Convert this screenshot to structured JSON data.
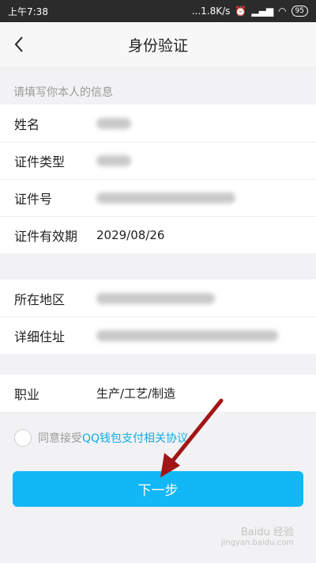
{
  "status_bar": {
    "time": "上午7:38",
    "network": "...1.8K/s",
    "battery": "95"
  },
  "header": {
    "title": "身份验证"
  },
  "section_hint": "请填写你本人的信息",
  "fields_personal": [
    {
      "label": "姓名",
      "value": null
    },
    {
      "label": "证件类型",
      "value": null
    },
    {
      "label": "证件号",
      "value": null
    },
    {
      "label": "证件有效期",
      "value": "2029/08/26"
    }
  ],
  "fields_address": [
    {
      "label": "所在地区",
      "value": null
    },
    {
      "label": "详细住址",
      "value": null
    }
  ],
  "occupation": {
    "label": "职业",
    "value": "生产/工艺/制造"
  },
  "agreement": {
    "prefix": "同意接受",
    "link": "QQ钱包支付相关协议"
  },
  "next_button": {
    "label": "下一步"
  },
  "watermark": {
    "text": "Baidu 经验",
    "sub": "jingyan.baidu.com"
  },
  "colors": {
    "accent": "#12b7f5",
    "link": "#12a9e6",
    "annotation_arrow": "#a31515"
  }
}
